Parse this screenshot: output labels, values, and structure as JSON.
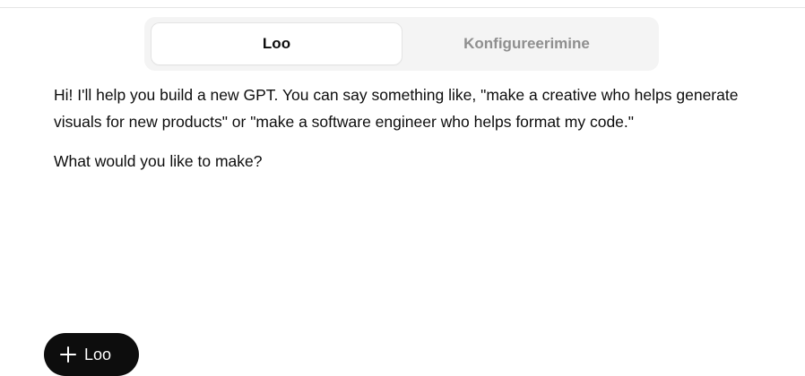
{
  "tabs": [
    {
      "label": "Loo",
      "active": true
    },
    {
      "label": "Konfigureerimine",
      "active": false
    }
  ],
  "message": {
    "paragraph1": "Hi! I'll help you build a new GPT. You can say something like, \"make a creative who helps generate visuals for new products\" or \"make a software engineer who helps format my code.\"",
    "paragraph2": "What would you like to make?"
  },
  "create_button": {
    "icon": "plus-icon",
    "label": "Loo"
  },
  "colors": {
    "tab_bar_bg": "#f4f4f4",
    "active_tab_bg": "#ffffff",
    "inactive_tab_text": "#8f8f8f",
    "button_bg": "#0d0d0d",
    "text": "#0d0d0d"
  }
}
